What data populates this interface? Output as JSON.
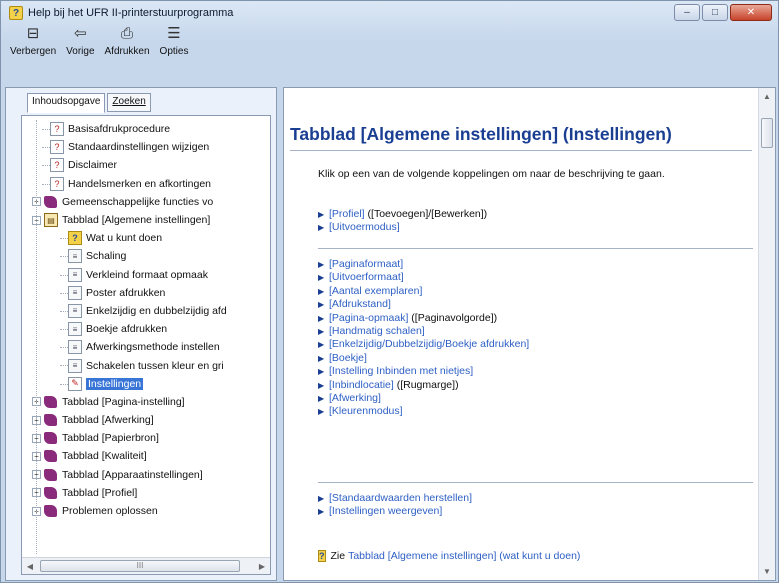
{
  "window": {
    "title": "Help bij het UFR II-printerstuurprogramma",
    "minimize_symbol": "–",
    "maximize_symbol": "□",
    "close_symbol": "✕"
  },
  "toolbar": {
    "buttons": [
      {
        "label": "Verbergen",
        "icon": "hide-icon",
        "glyph": "⊟"
      },
      {
        "label": "Vorige",
        "icon": "back-icon",
        "glyph": "⇦"
      },
      {
        "label": "Afdrukken",
        "icon": "print-icon",
        "glyph": "⎙"
      },
      {
        "label": "Opties",
        "icon": "options-icon",
        "glyph": "☰"
      }
    ]
  },
  "tabs": [
    "Inhoudsopgave",
    "Zoeken"
  ],
  "tree": [
    {
      "label": "Basisafdrukprocedure",
      "icon": "topic-icon",
      "level": 1
    },
    {
      "label": "Standaardinstellingen wijzigen",
      "icon": "topic-icon",
      "level": 1
    },
    {
      "label": "Disclaimer",
      "icon": "topic-icon",
      "level": 1
    },
    {
      "label": "Handelsmerken en afkortingen",
      "icon": "topic-icon",
      "level": 1
    },
    {
      "label": "Gemeenschappelijke functies vo",
      "icon": "book-icon",
      "level": 0,
      "expander": "+"
    },
    {
      "label": "Tabblad [Algemene instellingen]",
      "icon": "open-book-icon",
      "level": 0,
      "expander": "−"
    },
    {
      "label": "Wat u kunt doen",
      "icon": "help-page-icon",
      "level": 2
    },
    {
      "label": "Schaling",
      "icon": "page-icon",
      "level": 2
    },
    {
      "label": "Verkleind formaat opmaak",
      "icon": "page-icon",
      "level": 2
    },
    {
      "label": "Poster afdrukken",
      "icon": "page-icon",
      "level": 2
    },
    {
      "label": "Enkelzijdig en dubbelzijdig afd",
      "icon": "page-icon",
      "level": 2
    },
    {
      "label": "Boekje afdrukken",
      "icon": "page-icon",
      "level": 2
    },
    {
      "label": "Afwerkingsmethode instellen",
      "icon": "page-icon",
      "level": 2
    },
    {
      "label": "Schakelen tussen kleur en gri",
      "icon": "page-icon",
      "level": 2
    },
    {
      "label": "Instellingen",
      "icon": "settings-page-icon",
      "level": 2,
      "selected": true
    },
    {
      "label": "Tabblad [Pagina-instelling]",
      "icon": "book-icon",
      "level": 0,
      "expander": "+"
    },
    {
      "label": "Tabblad [Afwerking]",
      "icon": "book-icon",
      "level": 0,
      "expander": "+"
    },
    {
      "label": "Tabblad [Papierbron]",
      "icon": "book-icon",
      "level": 0,
      "expander": "+"
    },
    {
      "label": "Tabblad [Kwaliteit]",
      "icon": "book-icon",
      "level": 0,
      "expander": "+"
    },
    {
      "label": "Tabblad [Apparaatinstellingen]",
      "icon": "book-icon",
      "level": 0,
      "expander": "+"
    },
    {
      "label": "Tabblad [Profiel]",
      "icon": "book-icon",
      "level": 0,
      "expander": "+"
    },
    {
      "label": "Problemen oplossen",
      "icon": "book-icon",
      "level": 0,
      "expander": "+"
    }
  ],
  "hscroll_thumb_grip": "III",
  "content": {
    "title": "Tabblad [Algemene instellingen] (Instellingen)",
    "intro": "Klik op een van de volgende koppelingen om naar de beschrijving te gaan.",
    "group1": [
      {
        "link": "[Profiel]",
        "extra": " ([Toevoegen]/[Bewerken])"
      },
      {
        "link": "[Uitvoermodus]",
        "extra": ""
      }
    ],
    "group2": [
      {
        "link": "[Paginaformaat]",
        "extra": ""
      },
      {
        "link": "[Uitvoerformaat]",
        "extra": ""
      },
      {
        "link": "[Aantal exemplaren]",
        "extra": ""
      },
      {
        "link": "[Afdrukstand]",
        "extra": ""
      },
      {
        "link": "[Pagina-opmaak]",
        "extra": " ([Paginavolgorde])"
      },
      {
        "link": "[Handmatig schalen]",
        "extra": ""
      },
      {
        "link": "[Enkelzijdig/Dubbelzijdig/Boekje afdrukken]",
        "extra": ""
      },
      {
        "link": "[Boekje]",
        "extra": ""
      },
      {
        "link": "[Instelling Inbinden met nietjes]",
        "extra": ""
      },
      {
        "link": "[Inbindlocatie]",
        "extra": " ([Rugmarge])"
      },
      {
        "link": "[Afwerking]",
        "extra": ""
      },
      {
        "link": "[Kleurenmodus]",
        "extra": ""
      }
    ],
    "group3": [
      {
        "link": "[Standaardwaarden herstellen]",
        "extra": ""
      },
      {
        "link": "[Instellingen weergeven]",
        "extra": ""
      }
    ],
    "see_also": {
      "prefix": "Zie",
      "link": "Tabblad [Algemene instellingen] (wat kunt u doen)"
    }
  }
}
